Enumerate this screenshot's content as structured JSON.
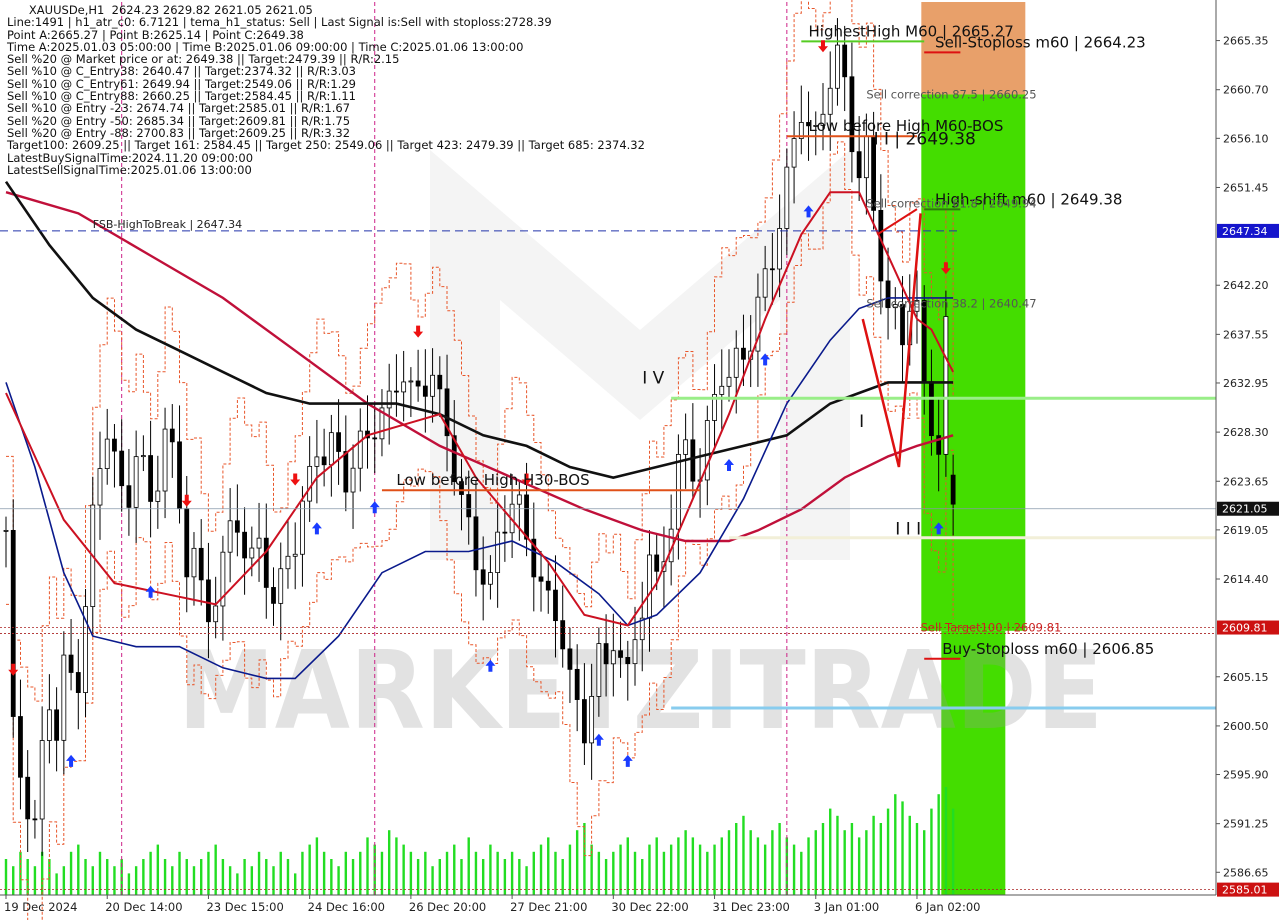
{
  "header": {
    "lines": [
      "XAUUSDe,H1  2624.23 2629.82 2621.05 2621.05",
      "Line:1491 | h1_atr_c0: 6.7121 | tema_h1_status: Sell | Last Signal is:Sell with stoploss:2728.39",
      "Point A:2665.27 | Point B:2625.14 | Point C:2649.38",
      "Time A:2025.01.03 05:00:00 | Time B:2025.01.06 09:00:00 | Time C:2025.01.06 13:00:00",
      "Sell %20 @ Market price or at: 2649.38 || Target:2479.39 || R/R:2.15",
      "Sell %10 @ C_Entry38: 2640.47 || Target:2374.32 || R/R:3.03",
      "Sell %10 @ C_Entry61: 2649.94 || Target:2549.06 || R/R:1.29",
      "Sell %10 @ C_Entry88: 2660.25 || Target:2584.45 || R/R:1.11",
      "Sell %10 @ Entry -23: 2674.74 || Target:2585.01 || R/R:1.67",
      "Sell %20 @ Entry -50: 2685.34 || Target:2609.81 || R/R:1.75",
      "Sell %20 @ Entry -88: 2700.83 || Target:2609.25 || R/R:3.32",
      "Target100: 2609.25 || Target 161: 2584.45 || Target 250: 2549.06 || Target 423: 2479.39 || Target 685: 2374.32",
      "LatestBuySignalTime:2024.11.20 09:00:00",
      "LatestSellSignalTime:2025.01.06 13:00:00"
    ]
  },
  "watermark": "MARKETZITRADE",
  "colors": {
    "candle": "#000000",
    "ma_red": "#cc1122",
    "ma_black": "#111111",
    "ma_blue": "#0a1a8c",
    "envelope": "#e8562a",
    "volume": "#22dd22",
    "zone_green": "#44dd00",
    "zone_orange": "#e8a06a",
    "signal_up": "#1a3cff",
    "signal_down": "#ee1111"
  },
  "chart_data": {
    "type": "candlestick",
    "symbol": "XAUUSDe",
    "timeframe": "H1",
    "ohlc_last": {
      "open": 2624.23,
      "high": 2629.82,
      "low": 2621.05,
      "close": 2621.05
    },
    "ylim": [
      2584.5,
      2669.0
    ],
    "y_ticks": [
      "2665.35",
      "2660.70",
      "2656.10",
      "2651.45",
      "2647.34",
      "2642.20",
      "2637.55",
      "2632.95",
      "2628.30",
      "2623.65",
      "2621.05",
      "2619.05",
      "2614.40",
      "2609.81",
      "2605.15",
      "2600.50",
      "2595.90",
      "2591.25",
      "2586.65",
      "2585.01"
    ],
    "y_tick_values": [
      2665.35,
      2660.7,
      2656.1,
      2651.45,
      2647.34,
      2642.2,
      2637.55,
      2632.95,
      2628.3,
      2623.65,
      2621.05,
      2619.05,
      2614.4,
      2609.81,
      2605.15,
      2600.5,
      2595.9,
      2591.25,
      2586.65,
      2585.01
    ],
    "highlight_ticks": [
      {
        "label": "2647.34",
        "bg": "#1515cc",
        "fg": "#ffffff"
      },
      {
        "label": "2621.05",
        "bg": "#111111",
        "fg": "#ffffff"
      },
      {
        "label": "2609.81",
        "bg": "#cc1111",
        "fg": "#ffffff"
      },
      {
        "label": "2585.01",
        "bg": "#cc1111",
        "fg": "#ffffff"
      }
    ],
    "x_labels": [
      "19 Dec 2024",
      "20 Dec 14:00",
      "23 Dec 15:00",
      "24 Dec 16:00",
      "26 Dec 20:00",
      "27 Dec 21:00",
      "30 Dec 22:00",
      "31 Dec 23:00",
      "3 Jan 01:00",
      "6 Jan 02:00"
    ],
    "x_label_bars": [
      0,
      14,
      28,
      42,
      56,
      70,
      84,
      98,
      112,
      126
    ],
    "bars": 132,
    "candle_path": [
      [
        0,
        2619
      ],
      [
        1,
        2600
      ],
      [
        2,
        2596
      ],
      [
        3,
        2593
      ],
      [
        4,
        2591
      ],
      [
        5,
        2598
      ],
      [
        6,
        2603
      ],
      [
        7,
        2600
      ],
      [
        8,
        2606
      ],
      [
        9,
        2605
      ],
      [
        10,
        2605
      ],
      [
        11,
        2612
      ],
      [
        12,
        2620
      ],
      [
        13,
        2625
      ],
      [
        14,
        2629
      ],
      [
        15,
        2626
      ],
      [
        16,
        2622
      ],
      [
        17,
        2622
      ],
      [
        18,
        2627
      ],
      [
        19,
        2625
      ],
      [
        20,
        2621
      ],
      [
        21,
        2624
      ],
      [
        22,
        2629
      ],
      [
        23,
        2626
      ],
      [
        24,
        2621
      ],
      [
        25,
        2616
      ],
      [
        26,
        2617
      ],
      [
        27,
        2613
      ],
      [
        28,
        2611
      ],
      [
        29,
        2613
      ],
      [
        30,
        2616
      ],
      [
        31,
        2619
      ],
      [
        32,
        2620
      ],
      [
        33,
        2617
      ],
      [
        34,
        2616
      ],
      [
        35,
        2618
      ],
      [
        36,
        2615
      ],
      [
        37,
        2612
      ],
      [
        38,
        2614
      ],
      [
        39,
        2617
      ],
      [
        40,
        2618
      ],
      [
        41,
        2621
      ],
      [
        42,
        2624
      ],
      [
        43,
        2627
      ],
      [
        44,
        2626
      ],
      [
        45,
        2627
      ],
      [
        46,
        2626
      ],
      [
        47,
        2624
      ],
      [
        48,
        2625
      ],
      [
        49,
        2627
      ],
      [
        50,
        2628
      ],
      [
        51,
        2629
      ],
      [
        52,
        2630
      ],
      [
        53,
        2631
      ],
      [
        54,
        2633
      ],
      [
        55,
        2634
      ],
      [
        56,
        2632
      ],
      [
        57,
        2632
      ],
      [
        58,
        2633
      ],
      [
        59,
        2634
      ],
      [
        60,
        2631
      ],
      [
        61,
        2628
      ],
      [
        62,
        2625
      ],
      [
        63,
        2622
      ],
      [
        64,
        2619
      ],
      [
        65,
        2616
      ],
      [
        66,
        2615
      ],
      [
        67,
        2614
      ],
      [
        68,
        2618
      ],
      [
        69,
        2620
      ],
      [
        70,
        2622
      ],
      [
        71,
        2621
      ],
      [
        72,
        2618
      ],
      [
        73,
        2616
      ],
      [
        74,
        2614
      ],
      [
        75,
        2612
      ],
      [
        76,
        2611
      ],
      [
        77,
        2609
      ],
      [
        78,
        2605
      ],
      [
        79,
        2602
      ],
      [
        80,
        2600
      ],
      [
        81,
        2604
      ],
      [
        82,
        2607
      ],
      [
        83,
        2606
      ],
      [
        84,
        2609
      ],
      [
        85,
        2607
      ],
      [
        86,
        2605
      ],
      [
        87,
        2609
      ],
      [
        88,
        2612
      ],
      [
        89,
        2616
      ],
      [
        90,
        2614
      ],
      [
        91,
        2617
      ],
      [
        92,
        2620
      ],
      [
        93,
        2625
      ],
      [
        94,
        2627
      ],
      [
        95,
        2625
      ],
      [
        96,
        2624
      ],
      [
        97,
        2628
      ],
      [
        98,
        2632
      ],
      [
        99,
        2634
      ],
      [
        100,
        2633
      ],
      [
        101,
        2635
      ],
      [
        102,
        2636
      ],
      [
        103,
        2637
      ],
      [
        104,
        2640
      ],
      [
        105,
        2643
      ],
      [
        106,
        2645
      ],
      [
        107,
        2648
      ],
      [
        108,
        2652
      ],
      [
        109,
        2656
      ],
      [
        110,
        2659
      ],
      [
        111,
        2657
      ],
      [
        112,
        2656
      ],
      [
        113,
        2659
      ],
      [
        114,
        2662
      ],
      [
        115,
        2664
      ],
      [
        116,
        2661
      ],
      [
        117,
        2656
      ],
      [
        118,
        2653
      ],
      [
        119,
        2655
      ],
      [
        120,
        2649
      ],
      [
        121,
        2644
      ],
      [
        122,
        2640
      ],
      [
        123,
        2639
      ],
      [
        124,
        2637
      ],
      [
        125,
        2641
      ],
      [
        126,
        2640
      ],
      [
        127,
        2632
      ],
      [
        128,
        2629
      ],
      [
        129,
        2627
      ],
      [
        130,
        2638
      ],
      [
        131,
        2621
      ]
    ],
    "ma_red": [
      [
        0,
        2632
      ],
      [
        8,
        2620
      ],
      [
        15,
        2614
      ],
      [
        22,
        2613
      ],
      [
        29,
        2612
      ],
      [
        36,
        2617
      ],
      [
        43,
        2624
      ],
      [
        50,
        2628
      ],
      [
        55,
        2629
      ],
      [
        60,
        2630
      ],
      [
        65,
        2624
      ],
      [
        70,
        2620
      ],
      [
        75,
        2616
      ],
      [
        80,
        2611
      ],
      [
        86,
        2610
      ],
      [
        90,
        2614
      ],
      [
        95,
        2622
      ],
      [
        100,
        2630
      ],
      [
        105,
        2639
      ],
      [
        110,
        2647
      ],
      [
        114,
        2651
      ],
      [
        118,
        2651
      ],
      [
        122,
        2645
      ],
      [
        126,
        2639
      ],
      [
        128,
        2638
      ],
      [
        131,
        2634
      ]
    ],
    "ma_black": [
      [
        0,
        2652
      ],
      [
        6,
        2646
      ],
      [
        12,
        2641
      ],
      [
        18,
        2638
      ],
      [
        24,
        2636
      ],
      [
        30,
        2634
      ],
      [
        36,
        2632
      ],
      [
        42,
        2631
      ],
      [
        48,
        2631
      ],
      [
        54,
        2631
      ],
      [
        60,
        2630
      ],
      [
        66,
        2628
      ],
      [
        72,
        2627
      ],
      [
        78,
        2625
      ],
      [
        84,
        2624
      ],
      [
        90,
        2625
      ],
      [
        96,
        2626
      ],
      [
        102,
        2627
      ],
      [
        108,
        2628
      ],
      [
        114,
        2631
      ],
      [
        118,
        2632
      ],
      [
        122,
        2633
      ],
      [
        126,
        2633
      ],
      [
        131,
        2633
      ]
    ],
    "ma_blue": [
      [
        0,
        2633
      ],
      [
        4,
        2625
      ],
      [
        8,
        2615
      ],
      [
        12,
        2609
      ],
      [
        18,
        2608
      ],
      [
        24,
        2608
      ],
      [
        30,
        2606
      ],
      [
        36,
        2605
      ],
      [
        40,
        2605
      ],
      [
        46,
        2609
      ],
      [
        52,
        2615
      ],
      [
        58,
        2617
      ],
      [
        64,
        2617
      ],
      [
        70,
        2618
      ],
      [
        76,
        2616
      ],
      [
        82,
        2613
      ],
      [
        86,
        2610
      ],
      [
        90,
        2611
      ],
      [
        96,
        2615
      ],
      [
        102,
        2622
      ],
      [
        108,
        2631
      ],
      [
        114,
        2637
      ],
      [
        118,
        2640
      ],
      [
        122,
        2641
      ],
      [
        126,
        2641
      ],
      [
        131,
        2641
      ]
    ],
    "ma_darkred": [
      [
        0,
        2651
      ],
      [
        10,
        2649
      ],
      [
        20,
        2645
      ],
      [
        30,
        2641
      ],
      [
        40,
        2636
      ],
      [
        50,
        2631
      ],
      [
        60,
        2627
      ],
      [
        70,
        2624
      ],
      [
        80,
        2621
      ],
      [
        88,
        2619
      ],
      [
        94,
        2618
      ],
      [
        100,
        2618
      ],
      [
        104,
        2619
      ],
      [
        110,
        2621
      ],
      [
        116,
        2624
      ],
      [
        122,
        2626
      ],
      [
        126,
        2627
      ],
      [
        131,
        2628
      ]
    ],
    "levels": [
      {
        "label": "FSB-HighToBreak | 2647.34",
        "price": 2647.34,
        "x0": 0,
        "x1": 132,
        "color": "#2233aa",
        "dash": "8 5",
        "label_bar": 12
      },
      {
        "label": "Low before High   H30-BOS",
        "price": 2622.8,
        "x0": 52,
        "x1": 96,
        "color": "#e05018",
        "dash": "",
        "label_bar": 54
      },
      {
        "label": "Low before High   M60-BOS",
        "price": 2656.3,
        "x0": 108,
        "x1": 126,
        "color": "#e05018",
        "dash": "",
        "label_bar": 111
      },
      {
        "label": "HighestHigh   M60 | 2665.27",
        "price": 2665.27,
        "x0": 110,
        "x1": 127,
        "color": "#55cc22",
        "dash": "",
        "label_bar": 111
      },
      {
        "label": "Sell-Stoploss m60 | 2664.23",
        "price": 2664.23,
        "x0": 127,
        "x1": 132,
        "color": "#dd1111",
        "dash": "",
        "label_bar": 128.5
      },
      {
        "label": "High-shift m60 | 2649.38",
        "price": 2649.38,
        "x0": 127,
        "x1": 132,
        "color": "#2c7a0a",
        "dash": "",
        "label_bar": 128.5
      },
      {
        "label": "Buy-Stoploss m60 | 2606.85",
        "price": 2606.85,
        "x0": 127,
        "x1": 132,
        "color": "#dd1111",
        "dash": "",
        "label_bar": 129.5
      }
    ],
    "zone_labels": [
      {
        "text": "Sell correction 87.5 | 2660.25",
        "price": 2660.25
      },
      {
        "text": "Sell correction 61.8 | 2649.94",
        "price": 2649.94
      },
      {
        "text": "Sell correction 38.2 | 2640.47",
        "price": 2640.47
      },
      {
        "text": "Sell Target100 | 2609.81",
        "price": 2609.81
      }
    ],
    "wave_labels": [
      {
        "text": "I V",
        "bar": 88,
        "price": 2632.9
      },
      {
        "text": "I",
        "bar": 118,
        "price": 2628.8
      },
      {
        "text": "I I I",
        "bar": 123,
        "price": 2618.6
      },
      {
        "text": "I I | 2649.38",
        "bar": 120,
        "price": 2655.5
      }
    ],
    "volume": [
      5,
      4,
      6,
      5,
      4,
      6,
      5,
      3,
      4,
      6,
      7,
      5,
      4,
      6,
      5,
      4,
      5,
      3,
      4,
      5,
      6,
      7,
      5,
      4,
      6,
      5,
      4,
      5,
      6,
      7,
      5,
      4,
      3,
      5,
      4,
      6,
      5,
      4,
      6,
      5,
      3,
      6,
      7,
      8,
      6,
      5,
      4,
      6,
      5,
      6,
      8,
      7,
      6,
      9,
      8,
      7,
      6,
      5,
      6,
      4,
      5,
      6,
      7,
      5,
      8,
      6,
      5,
      7,
      6,
      5,
      6,
      5,
      4,
      6,
      7,
      8,
      6,
      5,
      7,
      9,
      10,
      7,
      6,
      5,
      6,
      7,
      8,
      6,
      5,
      7,
      8,
      6,
      7,
      8,
      9,
      8,
      7,
      6,
      7,
      8,
      9,
      10,
      11,
      9,
      8,
      7,
      9,
      10,
      8,
      7,
      6,
      8,
      9,
      10,
      12,
      11,
      9,
      10,
      8,
      9,
      11,
      10,
      12,
      14,
      13,
      11,
      10,
      9,
      12,
      14,
      15,
      12
    ]
  }
}
